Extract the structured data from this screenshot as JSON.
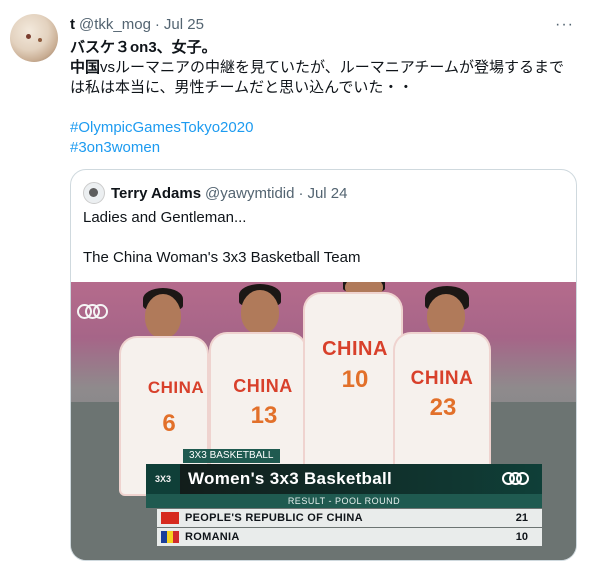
{
  "tweet": {
    "author_name": "t",
    "handle": "@tkk_mog",
    "separator": "·",
    "time": "Jul 25",
    "more_label": "···",
    "lines": {
      "line1": "バスケ３on3、女子。",
      "line2_bold": "中国",
      "line2_rest": "vsルーマニアの中継を見ていたが、ルーマニアチームが登場するまで",
      "line3": "は私は本当に、男性チームだと思い込んでいた・・"
    },
    "hashtags": [
      "#OlympicGamesTokyo2020",
      "#3on3women"
    ]
  },
  "quote": {
    "author_name": "Terry Adams",
    "handle": "@yawymtidid",
    "separator": "·",
    "time": "Jul 24",
    "text_line1": "Ladies and Gentleman...",
    "text_line2": "The China Woman's 3x3 Basketball Team"
  },
  "media": {
    "jersey_label": "CHINA",
    "player_numbers": [
      "6",
      "13",
      "10",
      "23"
    ],
    "overlay_top": "3X3 BASKETBALL",
    "overlay_logo": "3X3",
    "overlay_title": "Women's 3x3 Basketball",
    "overlay_sub": "RESULT - POOL ROUND",
    "results": [
      {
        "team": "People's Republic of China",
        "score": "21"
      },
      {
        "team": "Romania",
        "score": "10"
      }
    ]
  },
  "colors": {
    "link": "#1d9bf0",
    "secondary_text": "#536471",
    "border": "#cfd9de",
    "overlay_green": "#0f3f38"
  }
}
